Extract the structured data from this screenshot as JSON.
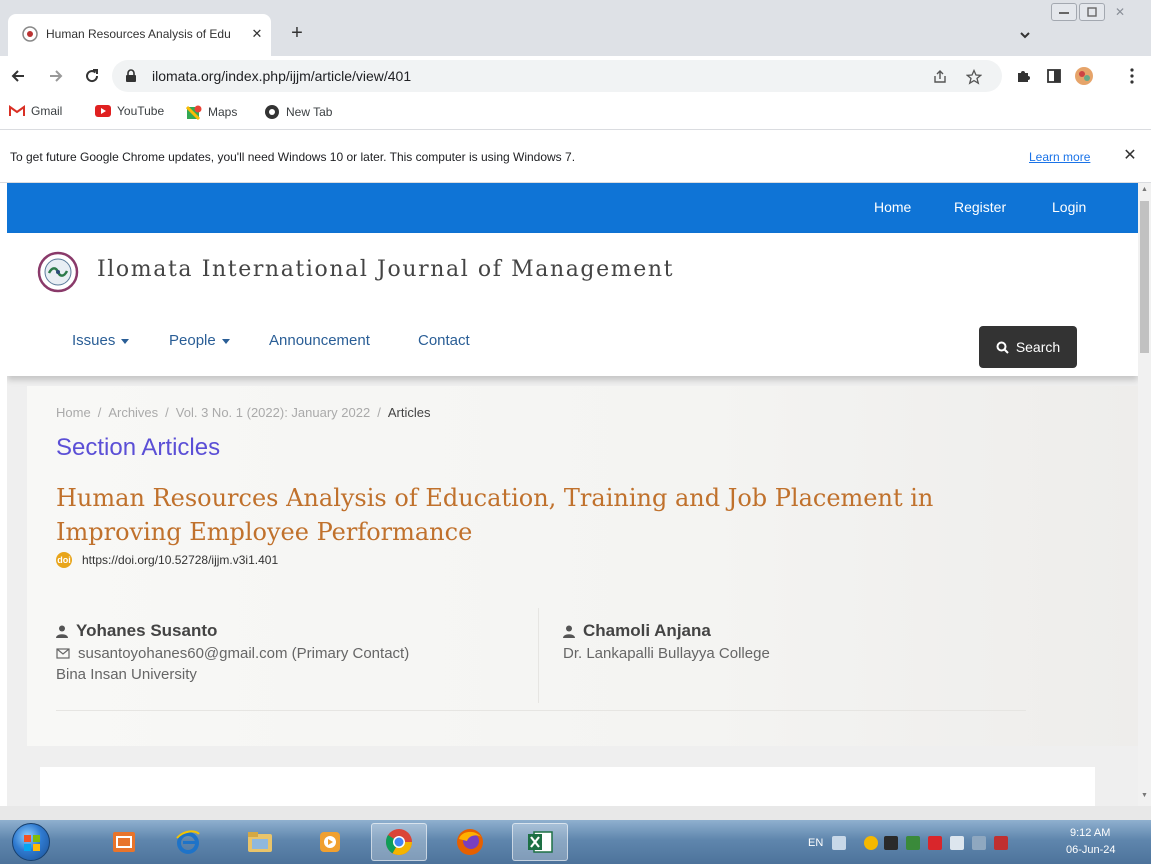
{
  "browser": {
    "tab_title": "Human Resources Analysis of Edu",
    "url": "ilomata.org/index.php/ijjm/article/view/401",
    "bookmarks": [
      {
        "label": "Gmail",
        "icon": "gmail-icon"
      },
      {
        "label": "YouTube",
        "icon": "youtube-icon"
      },
      {
        "label": "Maps",
        "icon": "maps-icon"
      },
      {
        "label": "New Tab",
        "icon": "chrome-icon"
      }
    ],
    "infobar": {
      "message": "To get future Google Chrome updates, you'll need Windows 10 or later. This computer is using Windows 7.",
      "link": "Learn more"
    }
  },
  "site": {
    "top_nav": [
      "Home",
      "Register",
      "Login"
    ],
    "title": "Ilomata International Journal of Management",
    "main_nav": [
      {
        "label": "Issues",
        "dropdown": true
      },
      {
        "label": "People",
        "dropdown": true
      },
      {
        "label": "Announcement",
        "dropdown": false
      },
      {
        "label": "Contact",
        "dropdown": false
      }
    ],
    "search_label": "Search",
    "accent_color": "#0f74d6"
  },
  "article": {
    "breadcrumbs": [
      "Home",
      "Archives",
      "Vol. 3 No. 1 (2022): January 2022",
      "Articles"
    ],
    "section": "Section Articles",
    "title": "Human Resources Analysis of Education, Training and Job Placement in Improving Employee Performance",
    "doi": "https://doi.org/10.52728/ijjm.v3i1.401",
    "authors": [
      {
        "name": "Yohanes Susanto",
        "email": "susantoyohanes60@gmail.com (Primary Contact)",
        "affiliation": "Bina Insan University"
      },
      {
        "name": "Chamoli Anjana",
        "affiliation": "Dr. Lankapalli Bullayya College"
      }
    ]
  },
  "taskbar": {
    "language": "EN",
    "time": "9:12 AM",
    "date": "06-Jun-24"
  }
}
